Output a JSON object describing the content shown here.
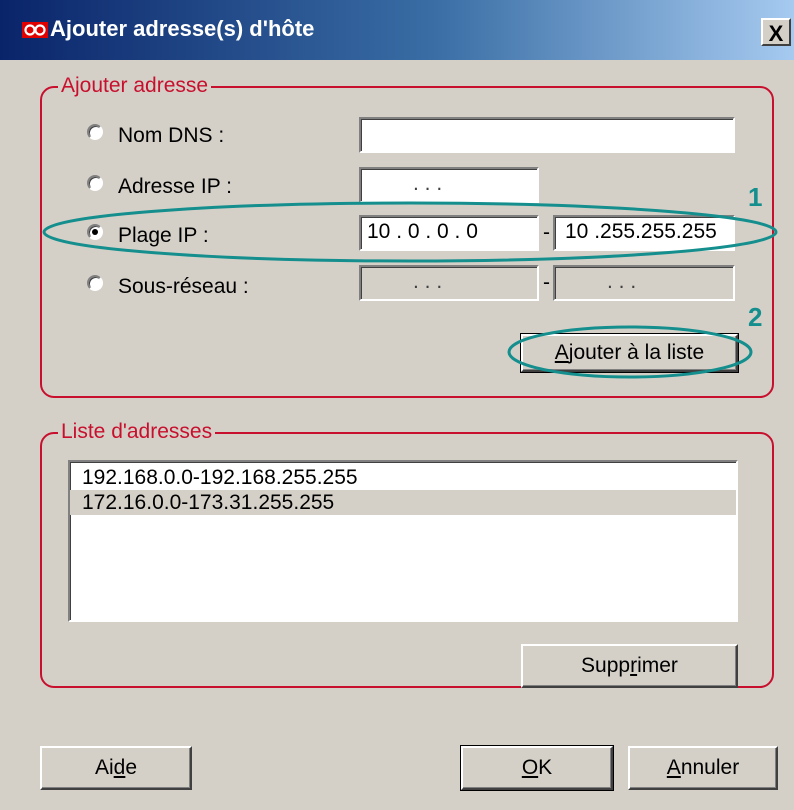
{
  "window": {
    "title": "Ajouter adresse(s) d'hôte",
    "close_label": "X"
  },
  "add_group": {
    "label": "Ajouter adresse",
    "options": [
      {
        "label": "Nom DNS :",
        "checked": false
      },
      {
        "label": "Adresse IP :",
        "checked": false
      },
      {
        "label": "Plage IP :",
        "checked": true
      },
      {
        "label": "Sous-réseau :",
        "checked": false
      }
    ],
    "dns_value": "",
    "ip_placeholder_dots": ".    .    .",
    "range_start": "10 .  0  .  0  .  0",
    "range_end": "10 .255.255.255",
    "subnet_dots": ".    .    .",
    "separator": "-",
    "add_button_label": "Ajouter à la liste",
    "add_button_accel": "A",
    "add_button_rest": "jouter à la liste"
  },
  "list_group": {
    "label": "Liste d'adresses",
    "items": [
      {
        "text": "192.168.0.0-192.168.255.255",
        "selected": false
      },
      {
        "text": "172.16.0.0-173.31.255.255",
        "selected": true
      }
    ],
    "delete_button_pre": "Supp",
    "delete_button_accel": "r",
    "delete_button_post": "imer"
  },
  "footer": {
    "help_pre": "Ai",
    "help_accel": "d",
    "help_post": "e",
    "ok_accel": "O",
    "ok_post": "K",
    "cancel_accel": "A",
    "cancel_post": "nnuler"
  },
  "annotations": {
    "one": "1",
    "two": "2",
    "color": "#158e8e"
  },
  "colors": {
    "accent_red": "#c8102e",
    "dialog_bg": "#d4d0c8"
  }
}
